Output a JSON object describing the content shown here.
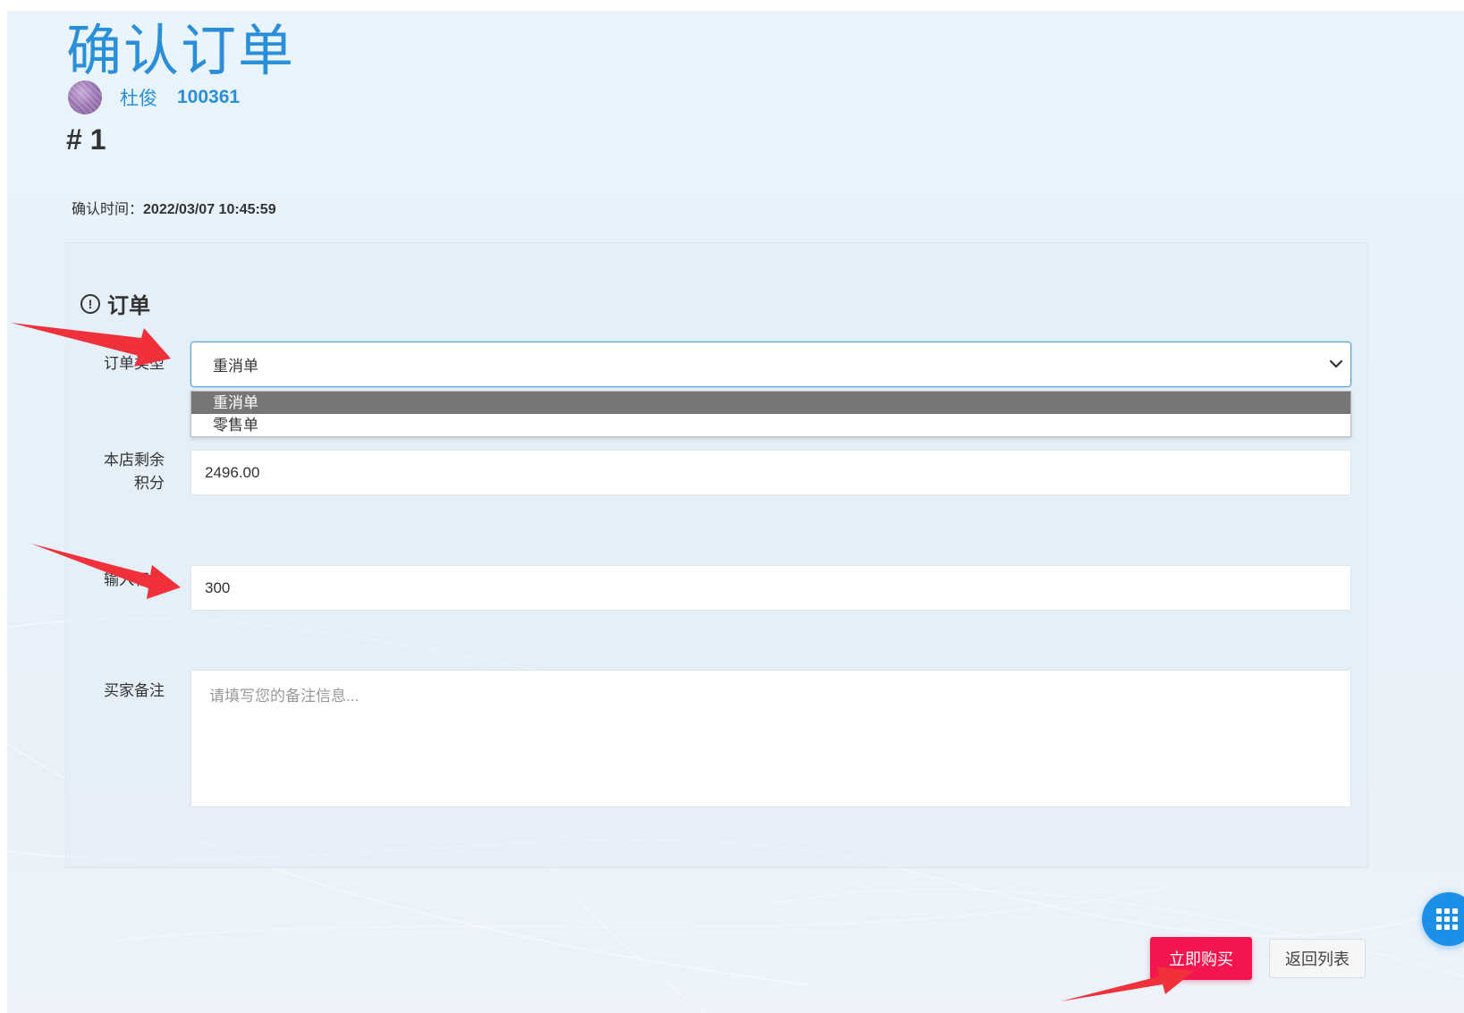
{
  "header": {
    "title": "确认订单",
    "username": "杜俊",
    "user_id": "100361",
    "order_no": "# 1",
    "confirm_time_label": "确认时间：",
    "confirm_time_value": "2022/03/07 10:45:59"
  },
  "form": {
    "section_title": "订单",
    "order_type": {
      "label": "订单类型",
      "selected": "重消单",
      "options": [
        "重消单",
        "零售单"
      ]
    },
    "remaining_points": {
      "label_line1": "本店剩余",
      "label_line2": "积分",
      "value": "2496.00"
    },
    "input_points": {
      "label": "输入积分",
      "value": "300"
    },
    "buyer_note": {
      "label": "买家备注",
      "placeholder": "请填写您的备注信息..."
    }
  },
  "actions": {
    "buy_now": "立即购买",
    "back_to_list": "返回列表"
  },
  "icons": {
    "info": "info-circle-icon",
    "chevron": "chevron-down-icon",
    "apps": "grid-apps-icon",
    "annotation": "red-arrow"
  },
  "colors": {
    "accent": "#2a8fd8",
    "buy_button": "#f3154d",
    "annotation_arrow": "#f0303a",
    "dropdown_selected": "#767676"
  }
}
